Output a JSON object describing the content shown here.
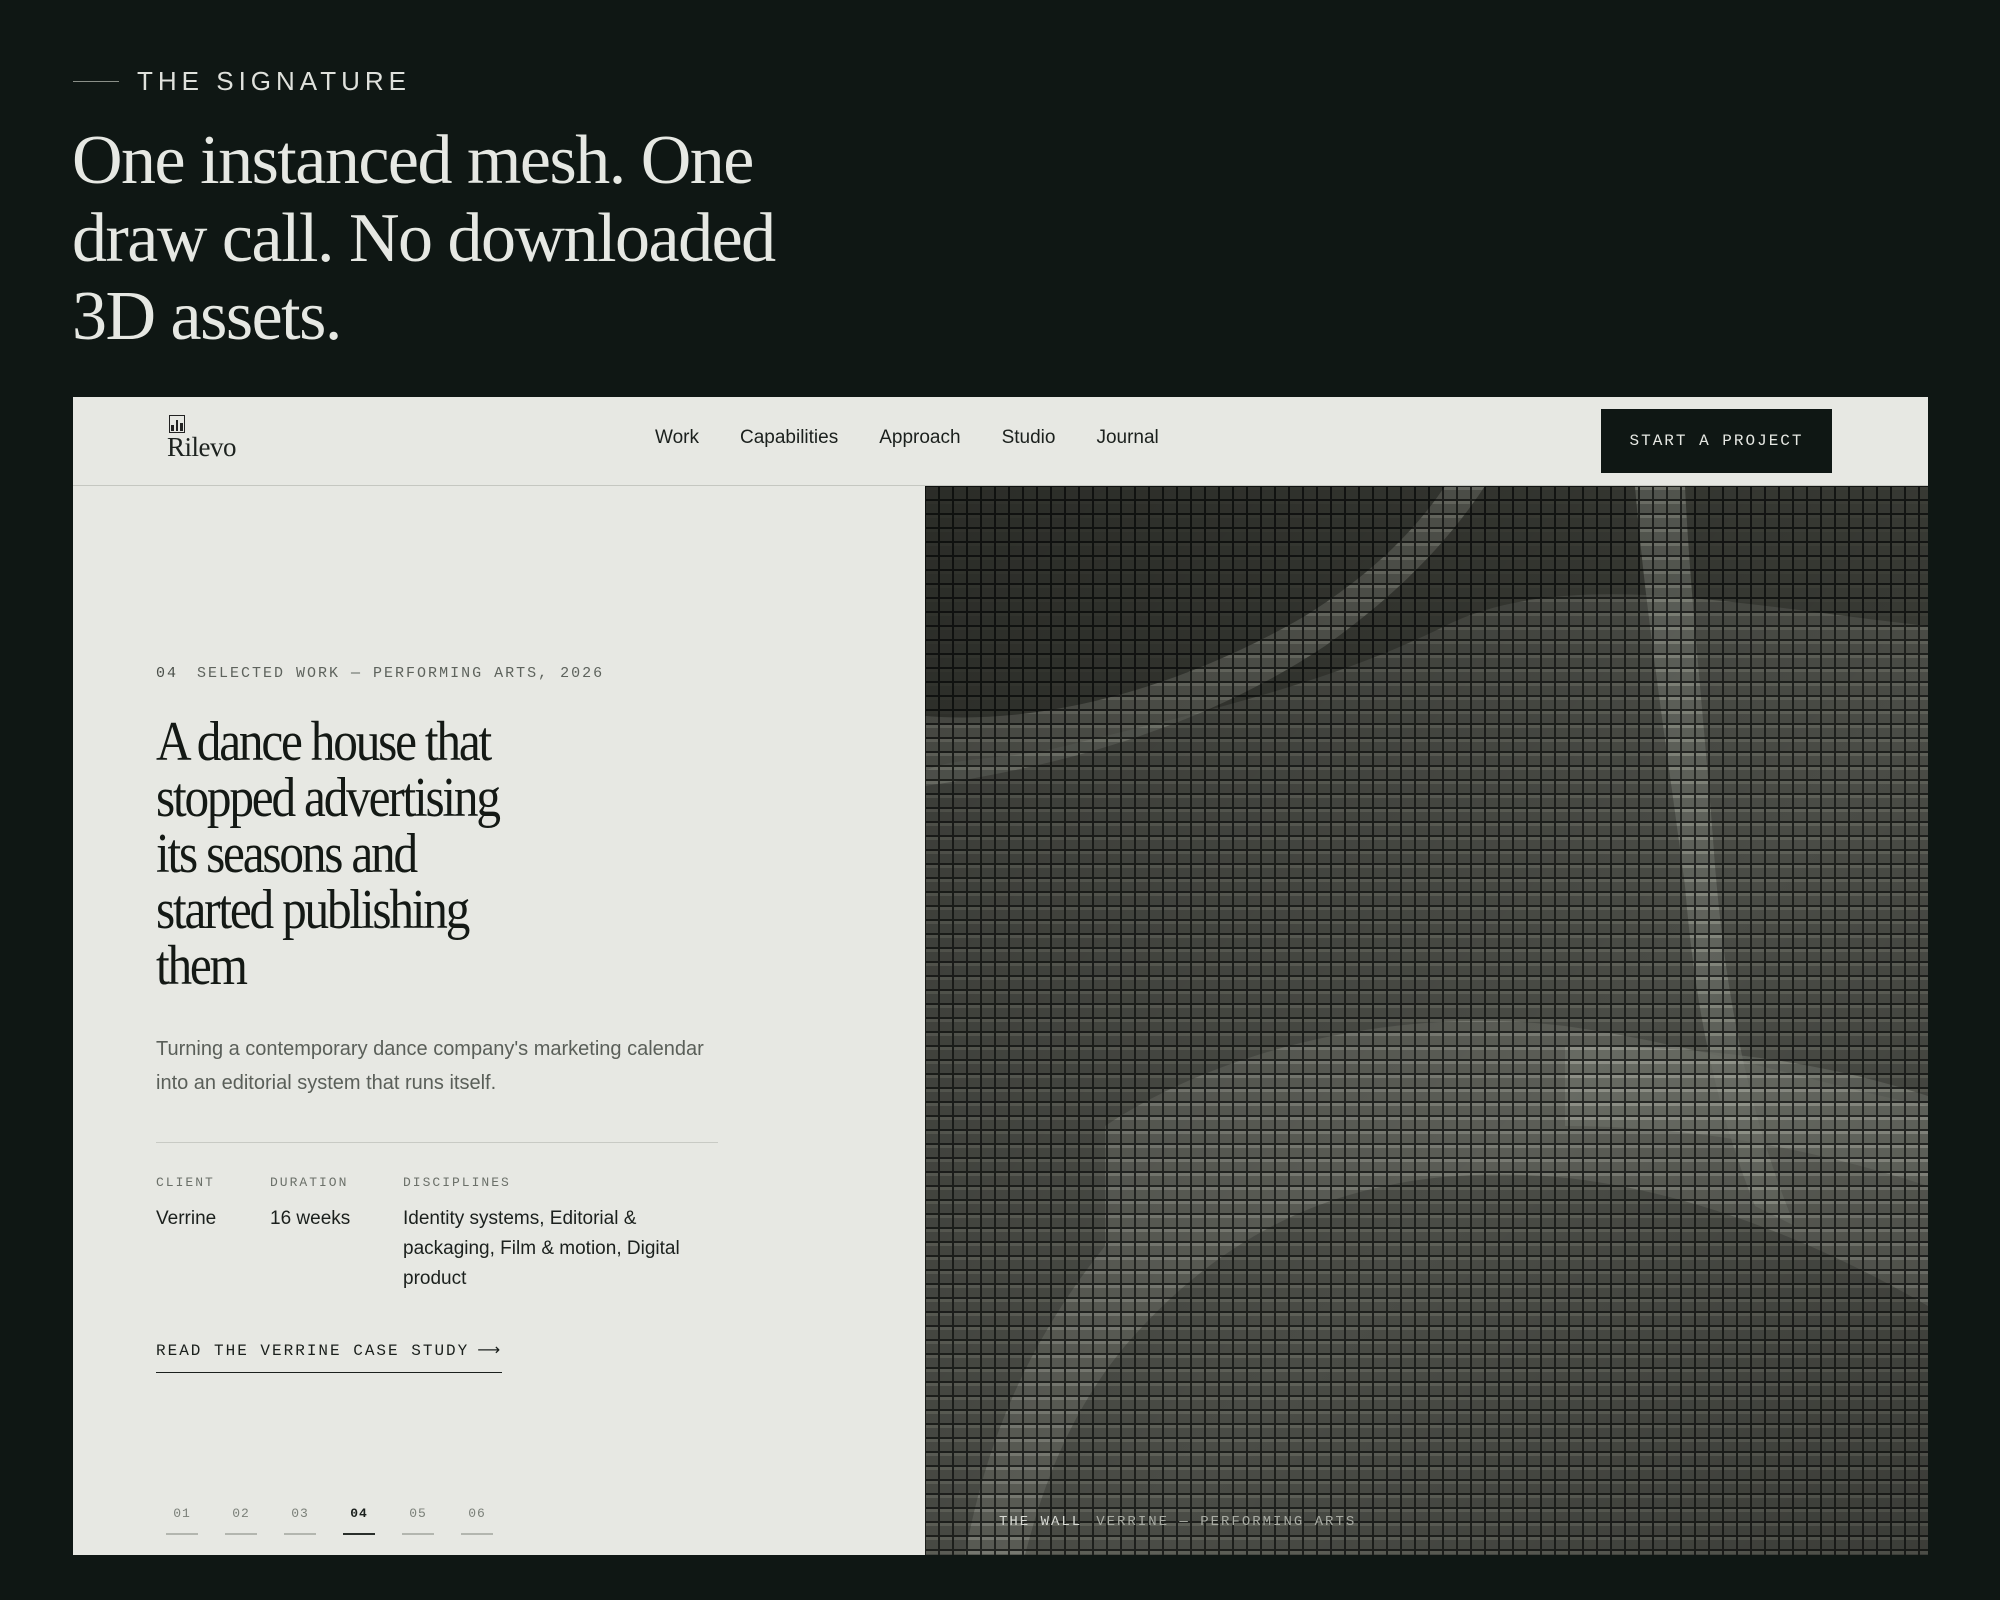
{
  "section": {
    "kicker": "THE SIGNATURE",
    "headline": "One instanced mesh. One draw call. No downloaded 3D assets."
  },
  "nav": {
    "logo_text": "Rilevo",
    "links": [
      "Work",
      "Capabilities",
      "Approach",
      "Studio",
      "Journal"
    ],
    "cta": "START A PROJECT"
  },
  "case": {
    "eyebrow_num": "04",
    "eyebrow": "SELECTED WORK — PERFORMING ARTS, 2026",
    "title": "A dance house that stopped advertising its seasons and started publishing them",
    "summary": "Turning a contemporary dance company's marketing calendar into an editorial system that runs itself.",
    "meta": {
      "client_label": "CLIENT",
      "client": "Verrine",
      "duration_label": "DURATION",
      "duration": "16 weeks",
      "disciplines_label": "DISCIPLINES",
      "disciplines": "Identity systems, Editorial & packaging, Film & motion, Digital product"
    },
    "link": "READ THE VERRINE CASE STUDY",
    "link_arrow": "⟶",
    "pager": [
      "01",
      "02",
      "03",
      "04",
      "05",
      "06"
    ],
    "pager_active": "04"
  },
  "visual": {
    "caption_title": "THE WALL",
    "caption_sub": "VERRINE — PERFORMING ARTS"
  },
  "colors": {
    "background": "#0f1714",
    "frame": "#e7e8e3",
    "ink": "#141915",
    "wall": "#3c3e39"
  }
}
